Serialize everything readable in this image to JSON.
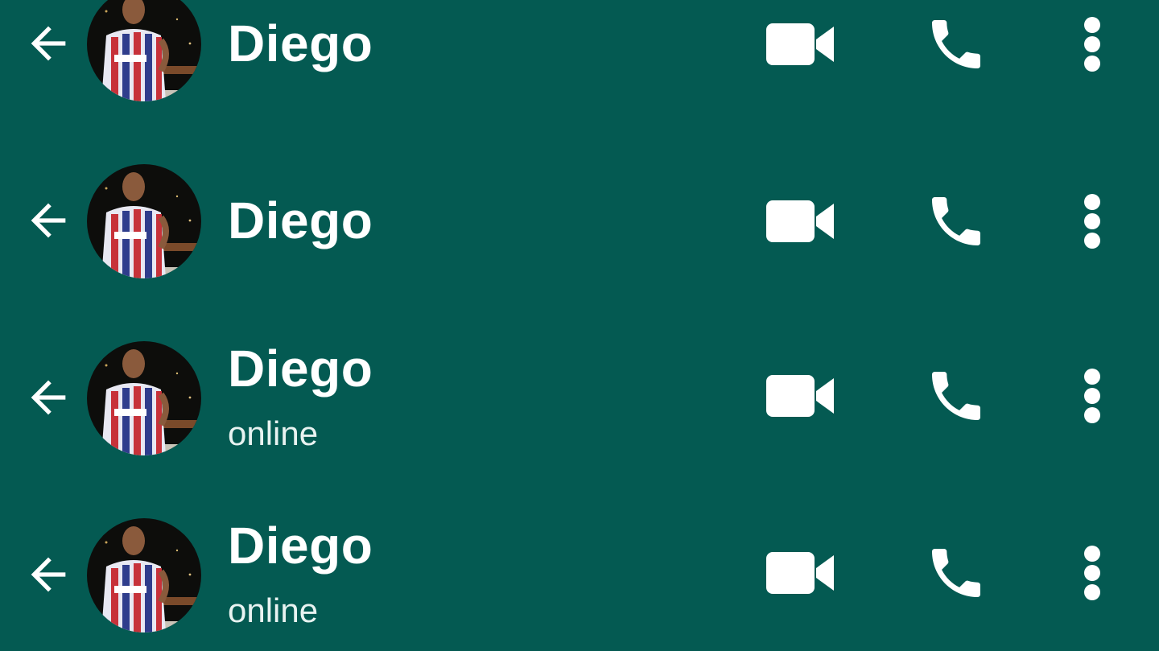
{
  "headers": [
    {
      "name": "Diego",
      "status": ""
    },
    {
      "name": "Diego",
      "status": ""
    },
    {
      "name": "Diego",
      "status": "online"
    },
    {
      "name": "Diego",
      "status": "online"
    }
  ],
  "icons": {
    "back": "arrow-left-icon",
    "video": "videocam-icon",
    "call": "phone-icon",
    "menu": "more-vertical-icon"
  },
  "colors": {
    "header_background": "#045a52",
    "foreground": "#ffffff"
  }
}
